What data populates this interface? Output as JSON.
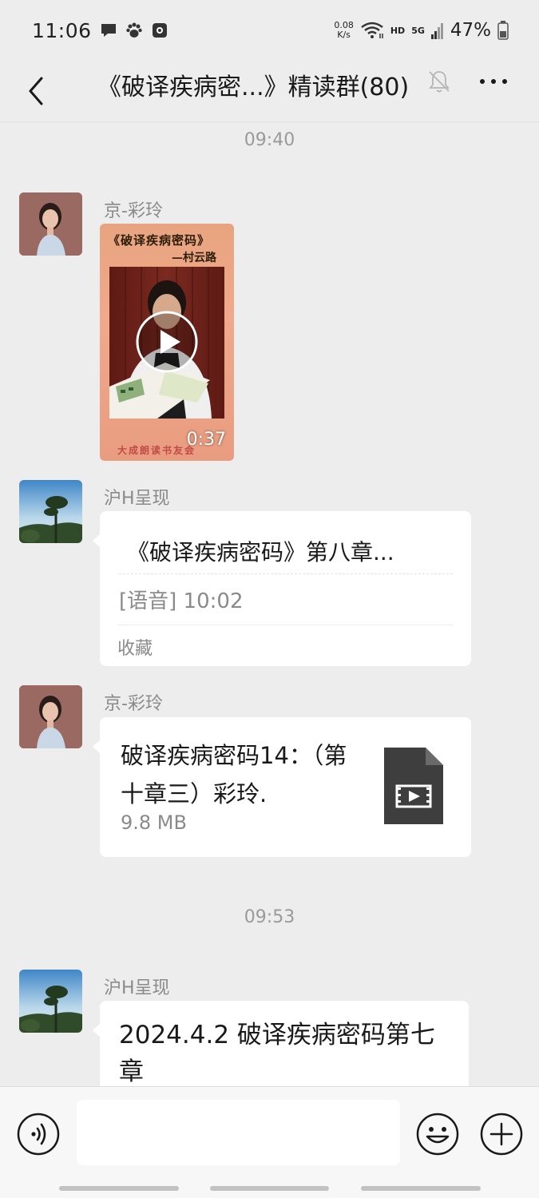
{
  "status_bar": {
    "time": "11:06",
    "net_speed_value": "0.08",
    "net_speed_unit": "K/s",
    "hd_label": "HD",
    "network_label": "5G",
    "battery": "47%"
  },
  "nav": {
    "title": "《破译疾病密...》精读群(80)"
  },
  "messages": {
    "time1": "09:40",
    "time2": "09:53",
    "m1": {
      "sender": "京-彩玲",
      "video_title_1": "《破译疾病密码》",
      "video_title_2": "—村云路",
      "video_footer": "大成朗读书友会",
      "duration": "0:37"
    },
    "m2": {
      "sender": "沪H呈现",
      "title": "《破译疾病密码》第八章...",
      "voice": "[语音] 10:02",
      "source": "收藏"
    },
    "m3": {
      "sender": "京-彩玲",
      "file_name": "破译疾病密码14：（第十章三）彩玲.",
      "file_size": "9.8 MB"
    },
    "m4": {
      "sender": "沪H呈现",
      "text": "2024.4.2 破译疾病密码第七章"
    }
  },
  "input": {
    "placeholder": ""
  },
  "colors": {
    "background": "#ededed",
    "bubble": "#ffffff",
    "meta_text": "#8a8a8a"
  }
}
